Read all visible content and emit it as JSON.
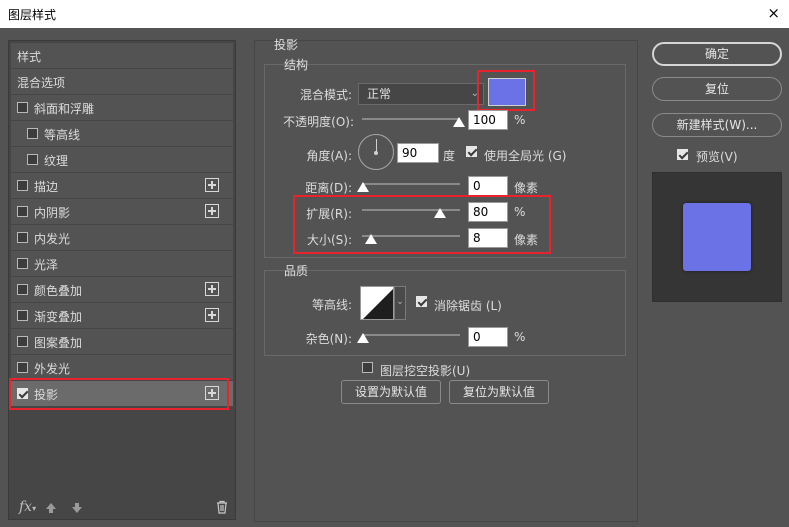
{
  "window": {
    "title": "图层样式",
    "close_glyph": "×"
  },
  "left": {
    "items": [
      {
        "label": "样式",
        "checkbox": false,
        "checked": false,
        "indent": 0,
        "plus": false
      },
      {
        "label": "混合选项",
        "checkbox": false,
        "checked": false,
        "indent": 0,
        "plus": false
      },
      {
        "label": "斜面和浮雕",
        "checkbox": true,
        "checked": false,
        "indent": 0,
        "plus": false
      },
      {
        "label": "等高线",
        "checkbox": true,
        "checked": false,
        "indent": 1,
        "plus": false
      },
      {
        "label": "纹理",
        "checkbox": true,
        "checked": false,
        "indent": 1,
        "plus": false
      },
      {
        "label": "描边",
        "checkbox": true,
        "checked": false,
        "indent": 0,
        "plus": true
      },
      {
        "label": "内阴影",
        "checkbox": true,
        "checked": false,
        "indent": 0,
        "plus": true
      },
      {
        "label": "内发光",
        "checkbox": true,
        "checked": false,
        "indent": 0,
        "plus": false
      },
      {
        "label": "光泽",
        "checkbox": true,
        "checked": false,
        "indent": 0,
        "plus": false
      },
      {
        "label": "颜色叠加",
        "checkbox": true,
        "checked": false,
        "indent": 0,
        "plus": true
      },
      {
        "label": "渐变叠加",
        "checkbox": true,
        "checked": false,
        "indent": 0,
        "plus": true
      },
      {
        "label": "图案叠加",
        "checkbox": true,
        "checked": false,
        "indent": 0,
        "plus": false
      },
      {
        "label": "外发光",
        "checkbox": true,
        "checked": false,
        "indent": 0,
        "plus": false
      },
      {
        "label": "投影",
        "checkbox": true,
        "checked": true,
        "indent": 0,
        "plus": true,
        "selected": true
      }
    ],
    "fx_label": "fx",
    "fx_sub": "▾"
  },
  "shadow": {
    "section_title": "投影",
    "structure_title": "结构",
    "blend_mode_label": "混合模式:",
    "blend_mode_value": "正常",
    "shadow_color": "#6b72e6",
    "opacity_label": "不透明度(O):",
    "opacity_value": "100",
    "opacity_unit": "%",
    "angle_label": "角度(A):",
    "angle_value": "90",
    "angle_unit": "度",
    "global_light_label": "使用全局光 (G)",
    "distance_label": "距离(D):",
    "distance_value": "0",
    "distance_unit": "像素",
    "spread_label": "扩展(R):",
    "spread_value": "80",
    "spread_unit": "%",
    "size_label": "大小(S):",
    "size_value": "8",
    "size_unit": "像素",
    "quality_title": "品质",
    "contour_label": "等高线:",
    "antialias_label": "消除锯齿 (L)",
    "noise_label": "杂色(N):",
    "noise_value": "0",
    "noise_unit": "%",
    "knockout_label": "图层挖空投影(U)",
    "set_default_label": "设置为默认值",
    "reset_default_label": "复位为默认值"
  },
  "right": {
    "ok_label": "确定",
    "reset_label": "复位",
    "new_style_label": "新建样式(W)...",
    "preview_label": "预览(V)",
    "preview_swatch_color": "#6b72e6"
  }
}
